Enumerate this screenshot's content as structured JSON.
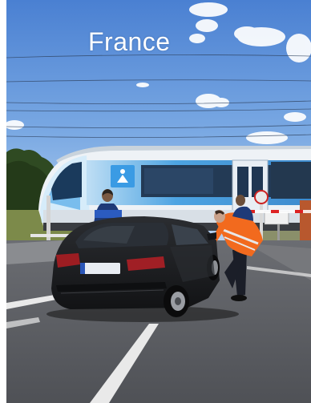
{
  "photo": {
    "caption": "France",
    "scene": "level-crossing-inspection",
    "colors": {
      "sky_top": "#4f86d6",
      "sky_bottom": "#a9c8ee",
      "train_body": "#e9edf2",
      "train_accent": "#2f8fd6",
      "road": "#5b5d62",
      "car": "#1d1f22",
      "vest": "#f26a1e"
    }
  }
}
